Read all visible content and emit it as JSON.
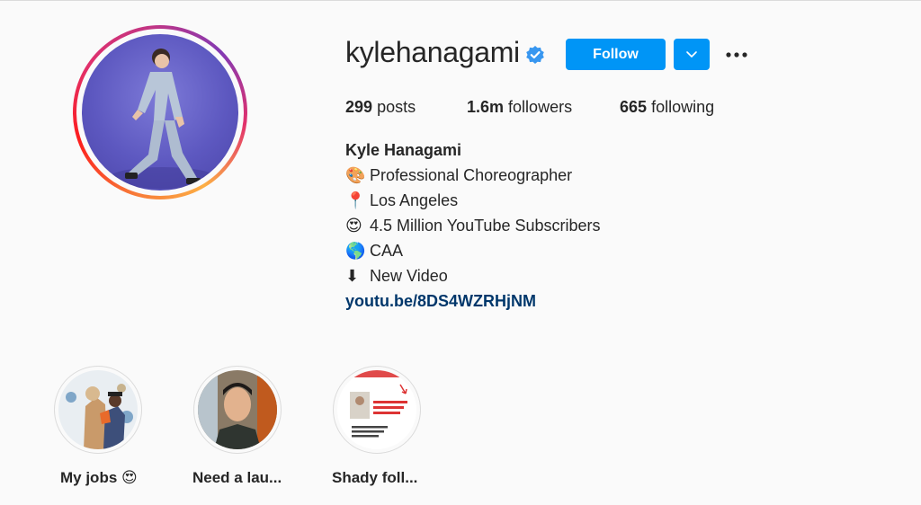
{
  "profile": {
    "username": "kylehanagami",
    "follow_label": "Follow",
    "more_icon": "more-horizontal-icon",
    "dropdown_icon": "chevron-down-icon",
    "verified_icon": "verified-badge-icon"
  },
  "stats": {
    "posts_count": "299",
    "posts_label": "posts",
    "followers_count": "1.6m",
    "followers_label": "followers",
    "following_count": "665",
    "following_label": "following"
  },
  "bio": {
    "full_name": "Kyle Hanagami",
    "lines": [
      {
        "emoji": "🎨",
        "text": "Professional Choreographer"
      },
      {
        "emoji": "📍",
        "text": "Los Angeles"
      },
      {
        "emoji": "😍",
        "text": "4.5 Million YouTube Subscribers"
      },
      {
        "emoji": "🌎",
        "text": "CAA"
      },
      {
        "emoji": "⬇",
        "text": "New Video"
      }
    ],
    "link": "youtu.be/8DS4WZRHjNM"
  },
  "highlights": [
    {
      "label": "My jobs 😍"
    },
    {
      "label": "Need a lau..."
    },
    {
      "label": "Shady foll..."
    }
  ],
  "colors": {
    "accent": "#0095f6",
    "link": "#00376b",
    "background": "#fafafa",
    "text": "#262626"
  }
}
